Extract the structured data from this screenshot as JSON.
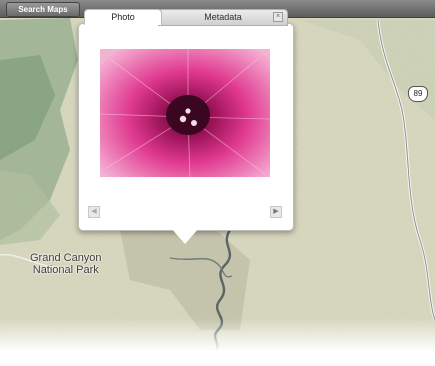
{
  "toolbar": {
    "search_label": "Search Maps"
  },
  "popup": {
    "tabs": [
      {
        "label": "Photo",
        "active": true
      },
      {
        "label": "Metadata",
        "active": false
      }
    ],
    "close_icon": "close-icon",
    "prev_icon": "left-arrow-icon",
    "next_icon": "right-arrow-icon"
  },
  "map": {
    "park_label_line1": "Grand Canyon",
    "park_label_line2": "National Park",
    "highway_label": "89",
    "pin_icon": "map-pin-icon"
  },
  "colors": {
    "topbar": "#6f6f6f",
    "map_land": "#dcdcc2",
    "river": "#5a6a6a",
    "forest": "#8fae86",
    "pin": "#2a9fd8"
  }
}
